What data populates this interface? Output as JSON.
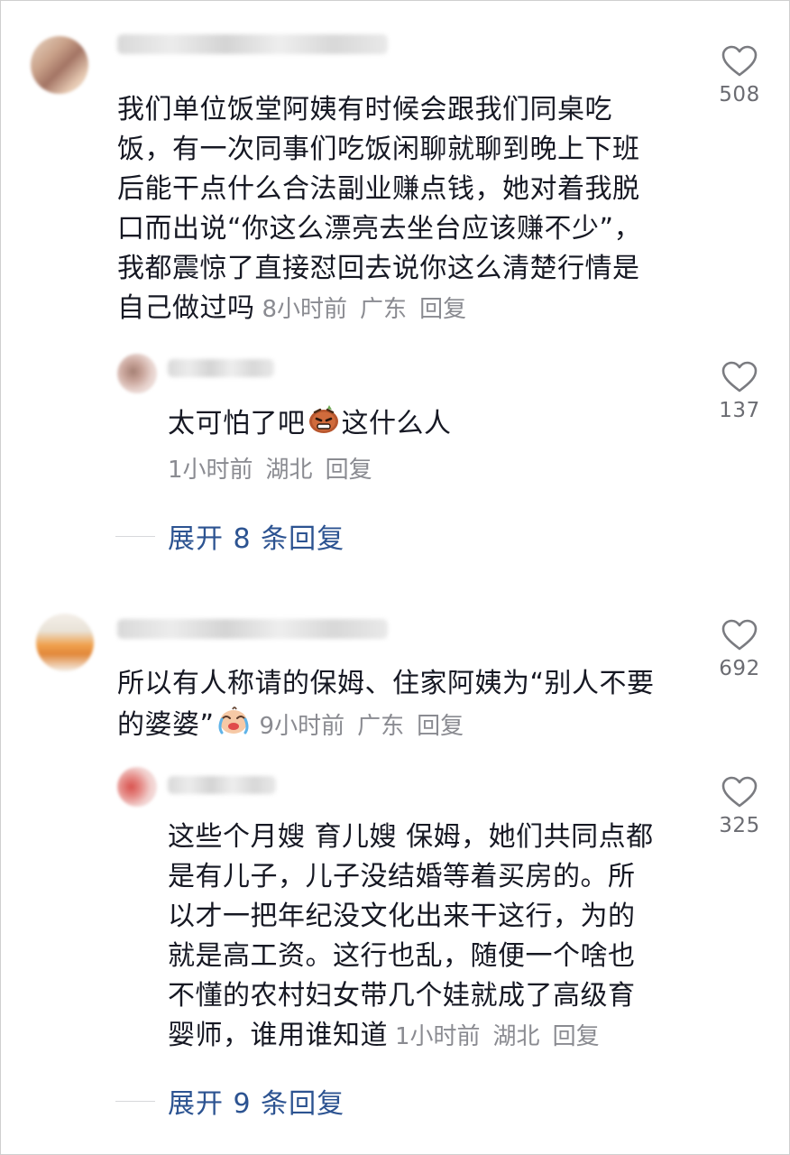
{
  "comments": [
    {
      "text_lines": [
        "我们单位饭堂阿姨有时候会跟我们同桌吃",
        "饭，有一次同事们吃饭闲聊就聊到晚上下班",
        "后能干点什么合法副业赚点钱，她对着我脱",
        "口而出说“你这么漂亮去坐台应该赚不少”，",
        "我都震惊了直接怼回去说你这么清楚行情是"
      ],
      "last_line": "自己做过吗",
      "time": "8小时前",
      "location": "广东",
      "reply_label": "回复",
      "likes": "508",
      "reply": {
        "text_before_emoji": "太可怕了吧",
        "emoji": "angry-face-emoji",
        "text_after_emoji": "这什么人",
        "time": "1小时前",
        "location": "湖北",
        "reply_label": "回复",
        "likes": "137"
      },
      "expand_label": "展开 8 条回复"
    },
    {
      "text_lines": [
        "所以有人称请的保姆、住家阿姨为“别人不要"
      ],
      "last_line": "的婆婆”",
      "emoji": "crying-face-emoji",
      "time": "9小时前",
      "location": "广东",
      "reply_label": "回复",
      "likes": "692",
      "reply": {
        "text_lines": [
          "这些个月嫂 育儿嫂 保姆，她们共同点都",
          "是有儿子，儿子没结婚等着买房的。所",
          "以才一把年纪没文化出来干这行，为的",
          "就是高工资。这行也乱，随便一个啥也",
          "不懂的农村妇女带几个娃就成了高级育"
        ],
        "last_line": "婴师，谁用谁知道",
        "time": "1小时前",
        "location": "湖北",
        "reply_label": "回复",
        "likes": "325"
      },
      "expand_label": "展开 9 条回复"
    }
  ],
  "icons": {
    "like": "heart-outline-icon"
  },
  "colors": {
    "text": "#161823",
    "meta": "#8a8b91",
    "expand": "#2c5391"
  }
}
